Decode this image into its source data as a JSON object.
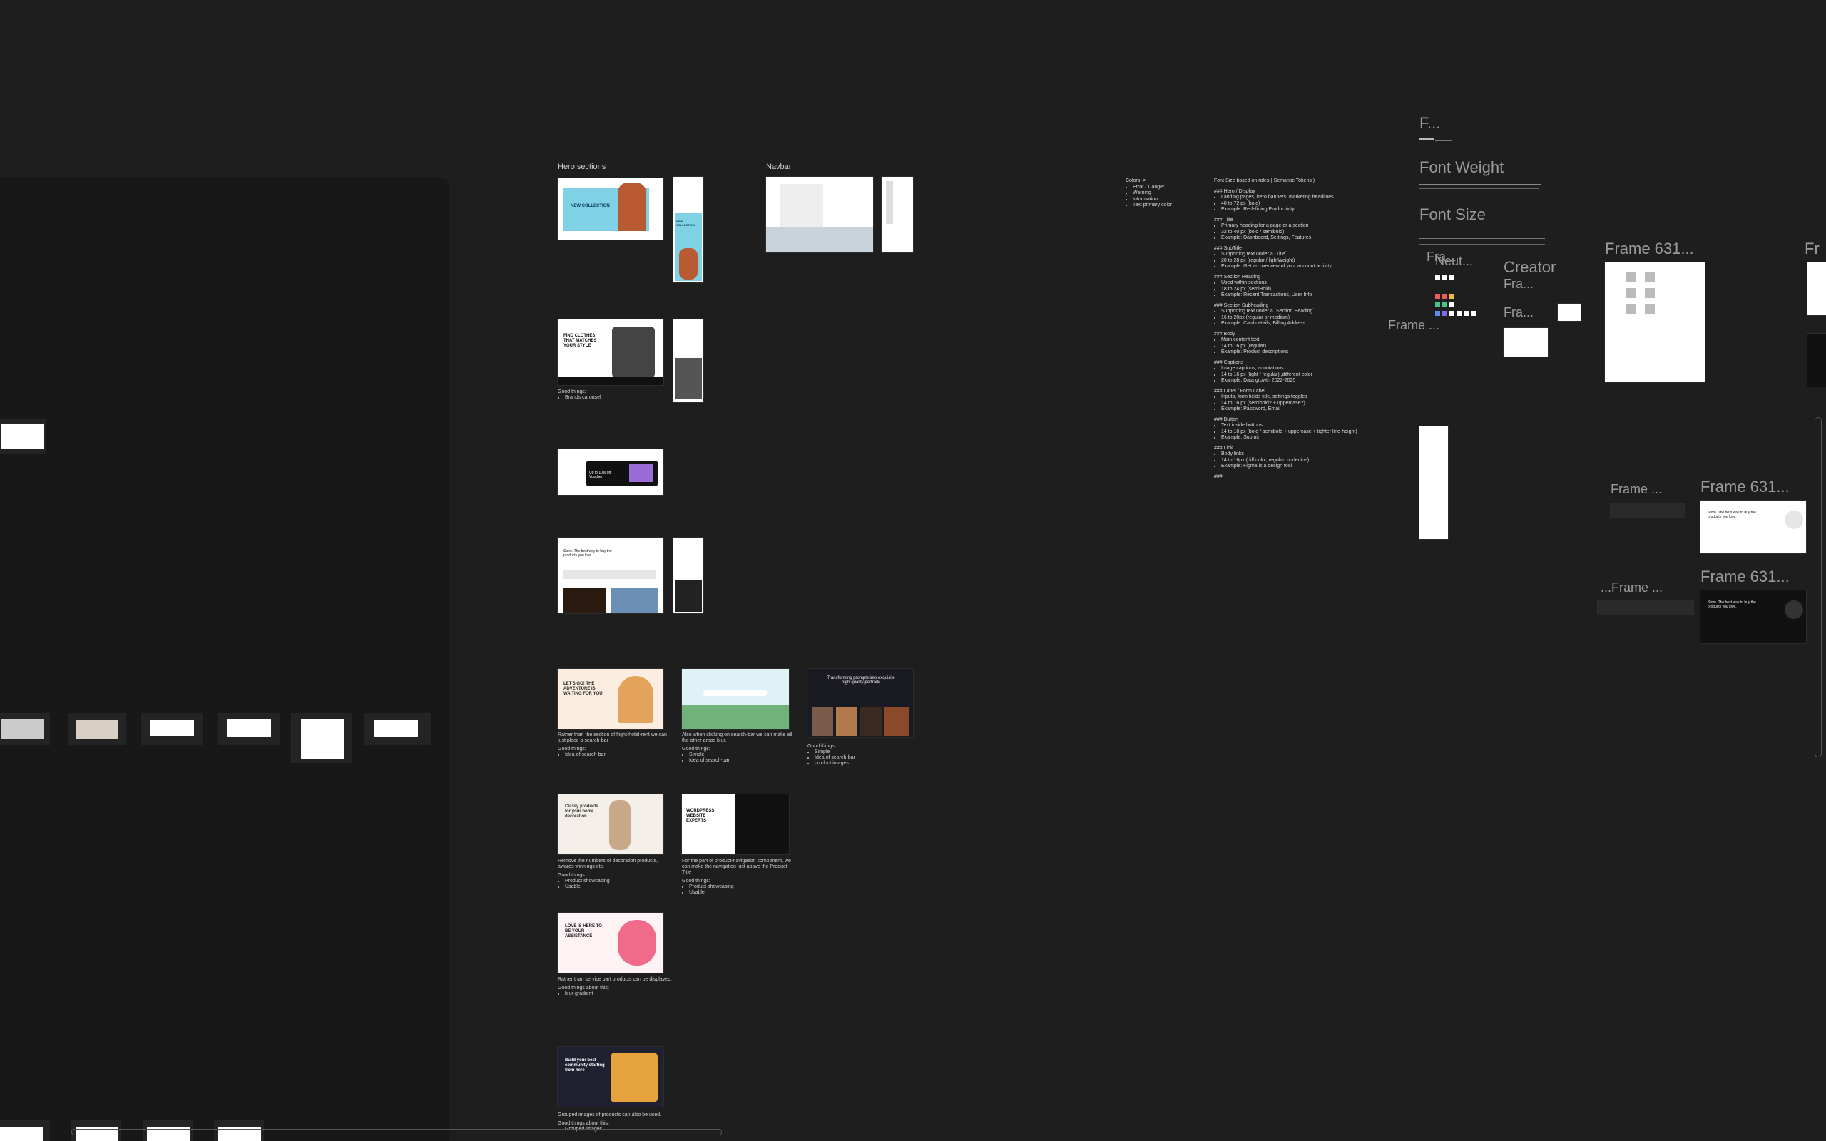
{
  "canvas": {
    "background": "#1e1e1e"
  },
  "sections": {
    "hero_sections": "Hero sections",
    "navbar": "Navbar"
  },
  "thumbnails": {
    "hero_new_collection": "NEW COLLECTION",
    "hero_new_collection_mobile": "NEW COLLECTION",
    "hero_find_clothes": "FIND CLOTHES THAT MATCHES YOUR STYLE",
    "hero_sale": "Up to 10% off Voucher",
    "hero_store": "Store. The best way to buy the products you love.",
    "hero_adventure": "LET'S GO! THE ADVENTURE IS WAITING FOR YOU",
    "hero_prompts": "Transforming prompts into exquisite high-quality portraits",
    "hero_decoration": "Classy products for your home decoration",
    "hero_wordpress": "WORDPRESS WEBSITE EXPERTS",
    "hero_love": "LOVE IS HERE TO BE YOUR ASSISTANCE",
    "hero_community": "Build your best community starting from here"
  },
  "captions": {
    "c1_title": "Good things:",
    "c1_items": [
      "Brands carousel"
    ],
    "c2_text": "Rather than the section of flight-hotel-rent we can just place a search-bar",
    "c2_title": "Good things:",
    "c2_items": [
      "Idea of search-bar"
    ],
    "c3_text": "Also when clicking on search-bar we can make all the other areas blur.",
    "c3_title": "Good things:",
    "c3_items": [
      "Simple",
      "Idea of search-bar"
    ],
    "c4_title": "Good things:",
    "c4_items": [
      "Simple",
      "Idea of search-bar",
      "product images"
    ],
    "c5_text": "Remove the numbers of decoration products, awards winnings etc.",
    "c5_title": "Good things:",
    "c5_items": [
      "Product showcasing",
      "Usable"
    ],
    "c6_text": "For the part of product-navigation component, we can make the navigation just above the Product Title",
    "c6_title": "Good things:",
    "c6_items": [
      "Product showcasing",
      "Usable"
    ],
    "c7_text": "Rather than service part products can be displayed.",
    "c7_title": "Good things about this:",
    "c7_items": [
      "blur-gradient"
    ],
    "c8_text": "Grouped images of products can also be used.",
    "c8_title": "Good things about this:",
    "c8_items": [
      "Grouped Images"
    ]
  },
  "colors_note": {
    "title": "Colors ->",
    "items": [
      "Error / Danger",
      "Warning",
      "Information",
      "Text primary color"
    ]
  },
  "font_note": {
    "title": "Font Size based on roles ( Semantic Tokens )",
    "blocks": [
      {
        "h": "### Hero / Display",
        "items": [
          "Landing pages, hero banners, marketing headlines",
          "48 to 72 px (bold)",
          "Example: Redefining Productivity"
        ]
      },
      {
        "h": "### Title",
        "items": [
          "Primary heading for a page or a section",
          "32 to 40 px (bold / semibold)",
          "Example: Dashboard, Settings, Features"
        ]
      },
      {
        "h": "### SubTitle",
        "items": [
          "Supporting text under a `Title`",
          "20 to 28 px (regular / lightWeight)",
          "Example: Get an overview of your account activity"
        ]
      },
      {
        "h": "### Section Heading",
        "items": [
          "Used within sections",
          "18 to 24 px (semiBold)",
          "Example: Recent Transactions, User Info"
        ]
      },
      {
        "h": "### Section Subheading",
        "items": [
          "Supporting text under a `Section Heading`",
          "16 to 20px (regular or medium)",
          "Example: Card details, Billing Address"
        ]
      },
      {
        "h": "### Body",
        "items": [
          "Main content text",
          "14 to 16 px (regular)",
          "Example: Product descriptions"
        ]
      },
      {
        "h": "### Captions",
        "items": [
          "Image captions, annotations",
          "14 to 16 px (light / regular) ,different color",
          "Example: Data growth 2022-2025"
        ]
      },
      {
        "h": "### Label / Form Label",
        "items": [
          "Inputs, form fields title, settings toggles",
          "14 to 16 px (semibold? + uppercase?)",
          "Example: Password, Email"
        ]
      },
      {
        "h": "### Button",
        "items": [
          "Text inside buttons",
          "14 to 18 px (bold / semibold + uppercase + tighter line-height)",
          "Example: Submit"
        ]
      },
      {
        "h": "### Link",
        "items": [
          "Body links",
          "14 to 16px (diff color, regular, underline)",
          "Example: Figma is a design tool"
        ]
      },
      {
        "h": "###",
        "items": []
      }
    ]
  },
  "frames": {
    "f_trunc": "F...",
    "font_weight": "Font Weight",
    "font_size": "Font Size",
    "frame_631_a": "Frame 631...",
    "fra_a": "Fra...",
    "neut": "Neut...",
    "creator": "Creator",
    "frame_left": "Frame ...",
    "fra_b": "Fra...",
    "fra_c": "Fra...",
    "frame_631_b": "Frame 631...",
    "frame_631_c": "Frame 631...",
    "frame_dots": "Frame ...",
    "frame_dots2": "...Frame ...",
    "fr_edge": "Fr"
  },
  "swatch_colors": [
    "#ffffff",
    "#cfcfcf",
    "#888888",
    "#e85d5d",
    "#f2b84b",
    "#4cc38a",
    "#5b8def",
    "#7a6cf0"
  ]
}
